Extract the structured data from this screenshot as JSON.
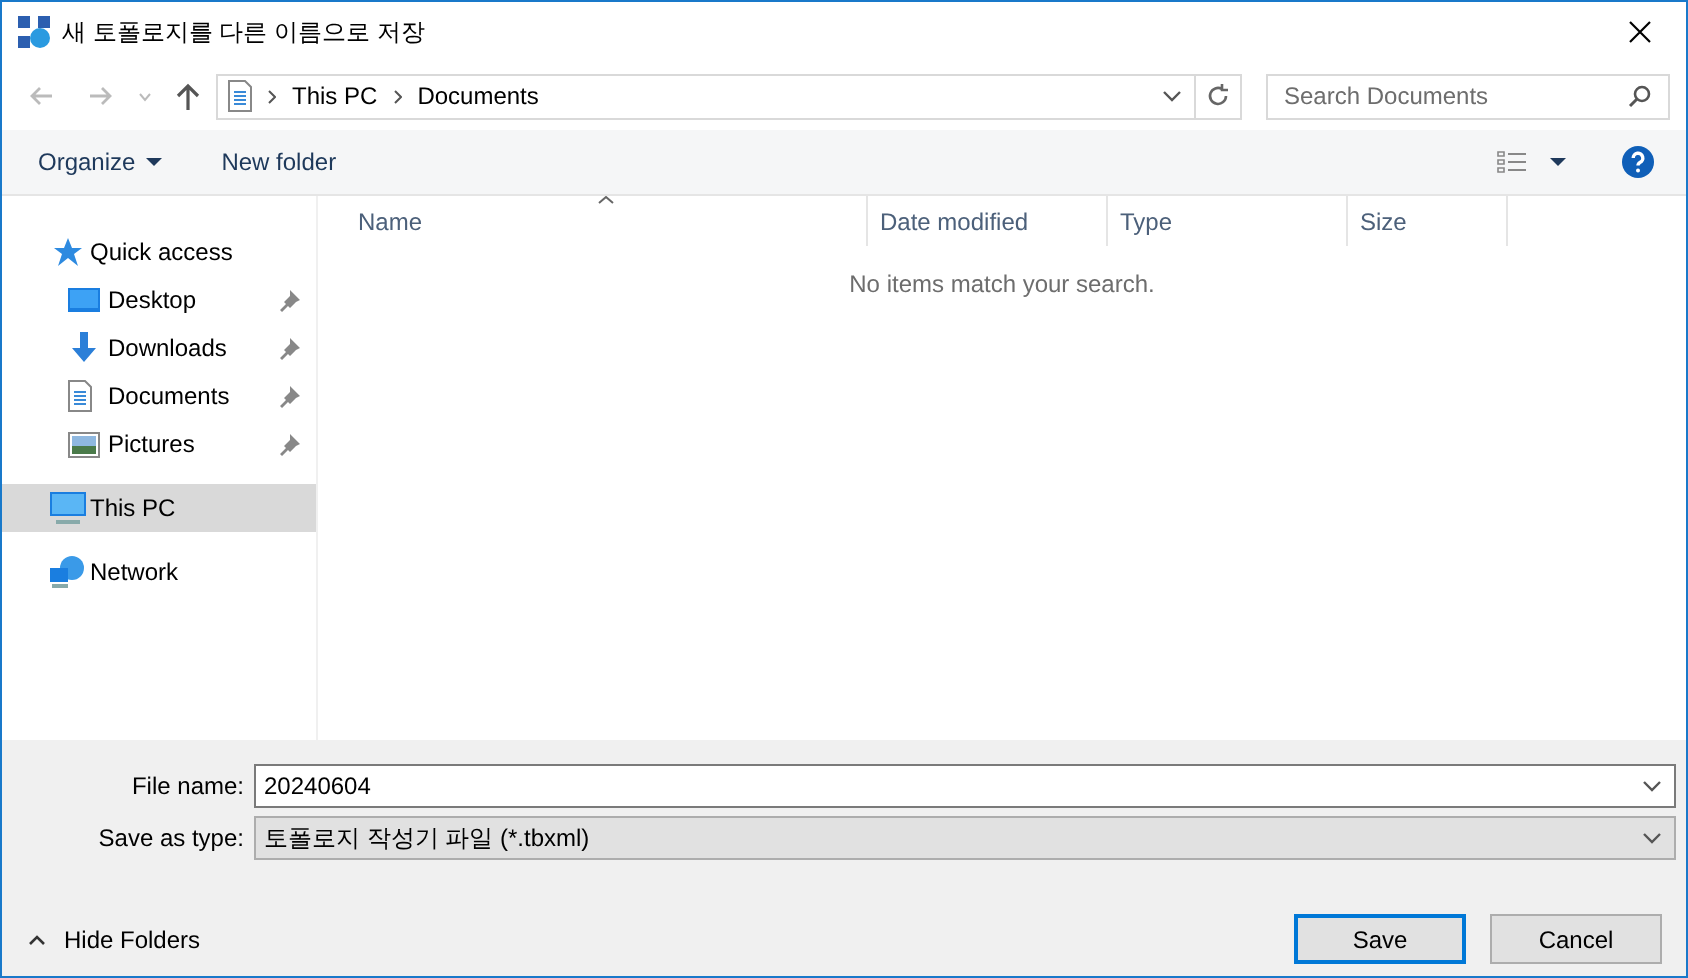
{
  "window": {
    "title": "새 토폴로지를 다른 이름으로 저장"
  },
  "address": {
    "crumbs": [
      "This PC",
      "Documents"
    ]
  },
  "search": {
    "placeholder": "Search Documents"
  },
  "toolbar": {
    "organize": "Organize",
    "new_folder": "New folder"
  },
  "sidebar": {
    "items": [
      {
        "label": "Quick access",
        "kind": "star",
        "selected": false,
        "children": [
          {
            "label": "Desktop",
            "kind": "desktop",
            "pinned": true,
            "selected": false
          },
          {
            "label": "Downloads",
            "kind": "download",
            "pinned": true,
            "selected": false
          },
          {
            "label": "Documents",
            "kind": "document",
            "pinned": true,
            "selected": false
          },
          {
            "label": "Pictures",
            "kind": "pictures",
            "pinned": true,
            "selected": false
          }
        ]
      },
      {
        "label": "This PC",
        "kind": "pc",
        "selected": true
      },
      {
        "label": "Network",
        "kind": "network",
        "selected": false
      }
    ]
  },
  "table": {
    "columns": [
      "Name",
      "Date modified",
      "Type",
      "Size"
    ],
    "empty_message": "No items match your search."
  },
  "form": {
    "file_name_label": "File name:",
    "file_name": "20240604",
    "type_label": "Save as type:",
    "type": "토폴로지 작성기 파일 (*.tbxml)"
  },
  "hide_folders": "Hide Folders",
  "buttons": [
    {
      "label": "Save",
      "default": true
    },
    {
      "label": "Cancel",
      "default": false
    }
  ]
}
